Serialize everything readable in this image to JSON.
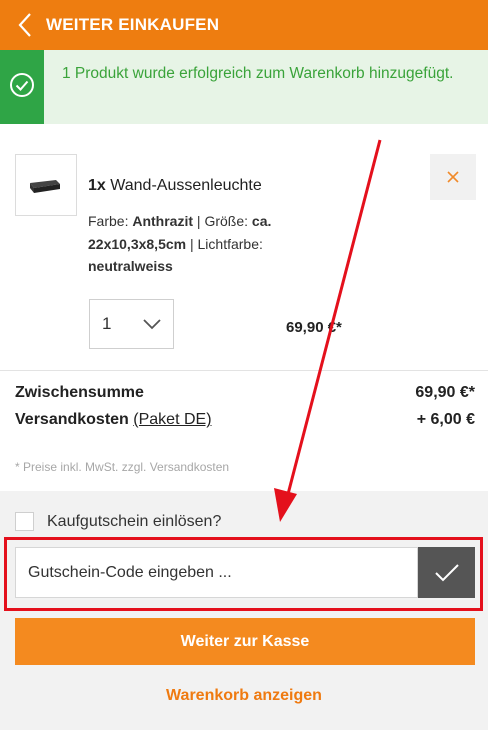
{
  "header": {
    "back_label": "WEITER EINKAUFEN",
    "background": "#ee7d10"
  },
  "notice": {
    "message": "1 Produkt wurde erfolgreich zum Warenkorb hinzugefügt.",
    "icon": "check-circle-icon",
    "accent": "#2fa546"
  },
  "item": {
    "quantity_prefix": "1x",
    "name": "Wand-Aussenleuchte",
    "attrs": {
      "farbe_label": "Farbe:",
      "farbe_value": "Anthrazit",
      "sep1": "|",
      "groesse_label": "Größe:",
      "groesse_value": "ca. 22x10,3x8,5cm",
      "sep2": "|",
      "lichtfarbe_label": "Lichtfarbe:",
      "lichtfarbe_value": "neutralweiss"
    },
    "qty_value": "1",
    "price": "69,90 €*"
  },
  "summary": {
    "subtotal_label": "Zwischensumme",
    "subtotal_value": "69,90 €*",
    "shipping_label": "Versandkosten",
    "shipping_link": "(Paket DE)",
    "shipping_value": "+ 6,00 €",
    "note": "* Preise inkl. MwSt. zzgl. Versandkosten"
  },
  "voucher": {
    "checkbox_label": "Kaufgutschein einlösen?",
    "input_placeholder": "Gutschein-Code eingeben ...",
    "highlight_color": "#e4101c"
  },
  "actions": {
    "checkout_label": "Weiter zur Kasse",
    "view_cart_label": "Warenkorb anzeigen",
    "accent": "#f48a1f"
  }
}
